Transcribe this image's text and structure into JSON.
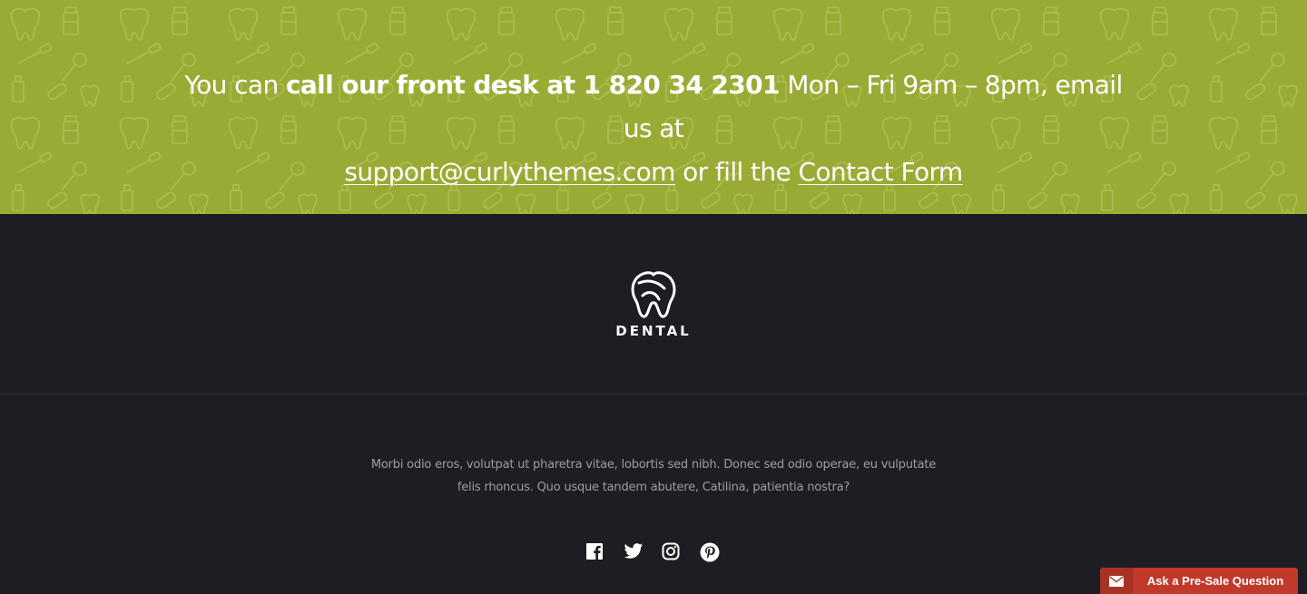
{
  "contact": {
    "text_before": "You can ",
    "bold_phone": "call our front desk at 1 820 34 2301",
    "text_hours": " Mon – Fri 9am – 8pm, email us at",
    "email_link": "support@curlythemes.com",
    "text_or": " or fill the ",
    "form_link": "Contact Form"
  },
  "footer": {
    "logo_text": "DENTAL",
    "about_line1": "Morbi odio eros, volutpat ut pharetra vitae, lobortis sed nibh. Donec sed odio operae, eu vulputate",
    "about_line2": "felis rhoncus. Quo usque tandem abutere, Catilina, patientia nostra?",
    "social": [
      {
        "icon": "facebook-icon"
      },
      {
        "icon": "twitter-icon"
      },
      {
        "icon": "instagram-icon"
      },
      {
        "icon": "pinterest-icon"
      }
    ]
  },
  "presale": {
    "label": "Ask a Pre-Sale Question",
    "icon": "envelope-icon"
  },
  "colors": {
    "banner_bg": "#9aab35",
    "footer_bg": "#1d1e23",
    "presale_bg": "#c0392b"
  }
}
